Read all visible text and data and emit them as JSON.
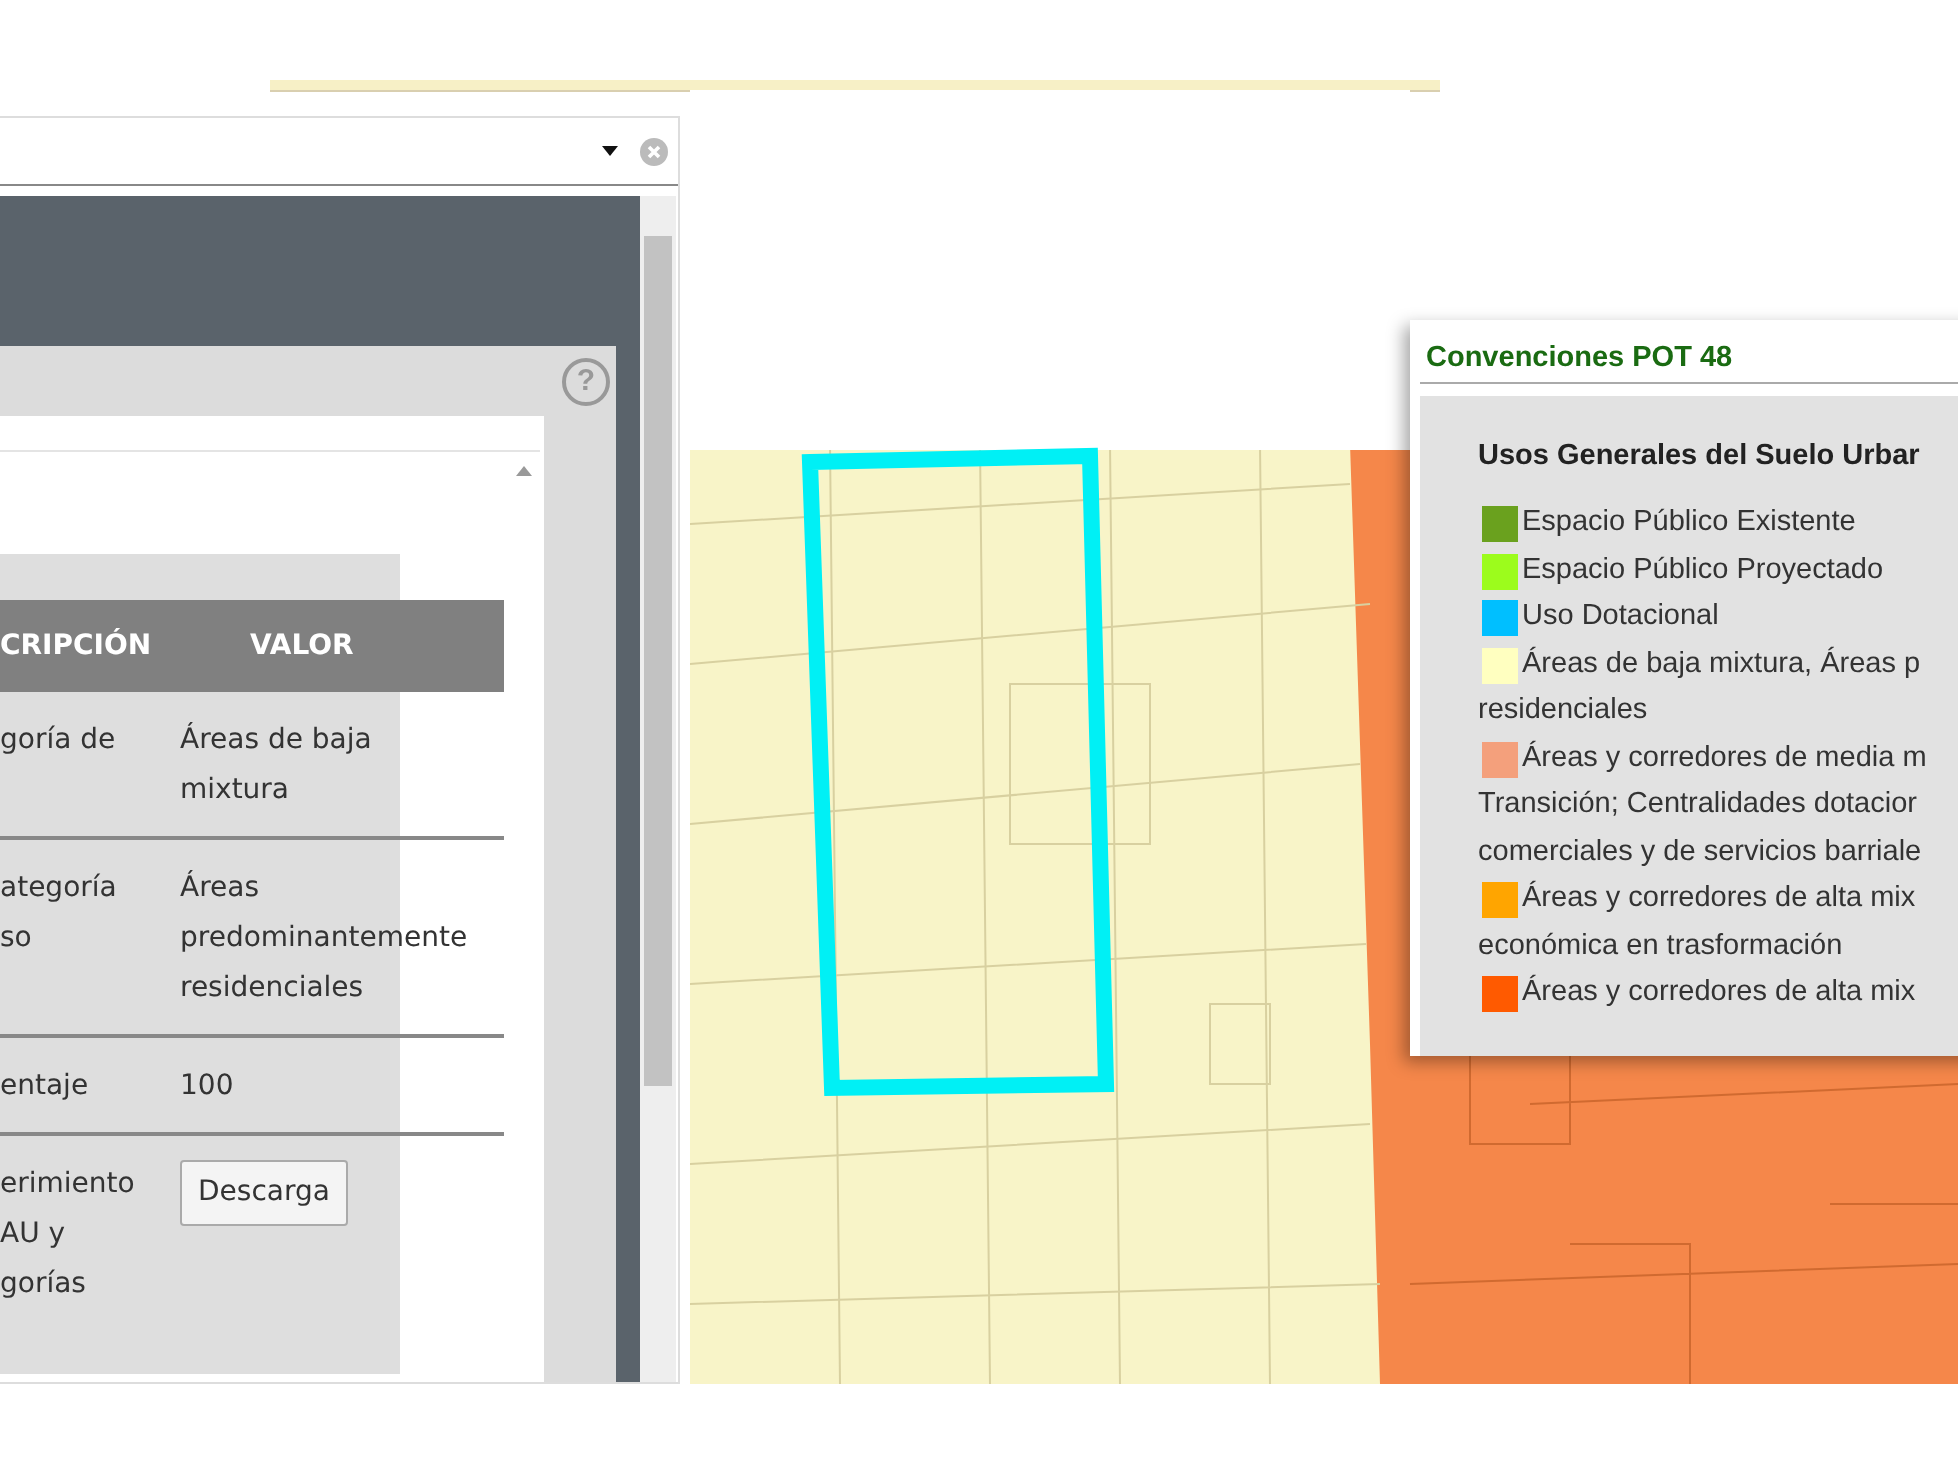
{
  "info_panel": {
    "help_button": "?",
    "table": {
      "columns": [
        "CRIPCIÓN",
        "VALOR"
      ],
      "rows": [
        {
          "kind": "text",
          "description": "goría de",
          "value": "Áreas de baja\nmixtura"
        },
        {
          "kind": "text",
          "description": "ategoría\nso",
          "value": "Áreas\npredominantemente\nresidenciales"
        },
        {
          "kind": "text",
          "description": "entaje",
          "value": "100"
        },
        {
          "kind": "button",
          "description": "erimiento\nAU y\ngorías",
          "value": "Descarga"
        }
      ]
    }
  },
  "legend": {
    "title": "Convenciones POT 48",
    "section_title": "Usos Generales del Suelo Urbar",
    "items": [
      {
        "color": "#6aa11e",
        "text": "Espacio Público Existente"
      },
      {
        "color": "#9cfc1c",
        "text": "Espacio Público Proyectado"
      },
      {
        "color": "#00bfff",
        "text": "Uso Dotacional"
      },
      {
        "color": "#ffffc0",
        "text": "Áreas de baja mixtura, Áreas p\nresidenciales"
      },
      {
        "color": "#f4a07c",
        "text": "Áreas y corredores de media m\nTransición; Centralidades dotacior\ncomerciales y de servicios barriale"
      },
      {
        "color": "#ffa500",
        "text": "Áreas y corredores de alta mix\neconómica en trasformación"
      },
      {
        "color": "#ff5a00",
        "text": "Áreas y corredores de alta mix"
      }
    ]
  }
}
